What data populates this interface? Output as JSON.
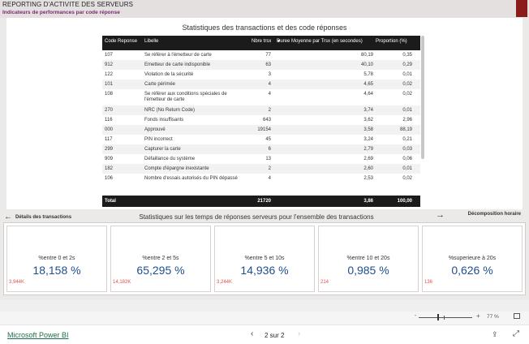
{
  "header": {
    "title": "REPORTING D'ACTIVITE DES SERVEURS",
    "subtitle": "Indicateurs de performances par code réponse"
  },
  "table": {
    "title": "Statistiques des transactions et des code réponses",
    "columns": [
      "Code Reponse",
      "Libelle",
      "Nbre trsx",
      "Duree Moyenne par Trsx (en secondes)",
      "Proportion (%)"
    ],
    "rows": [
      {
        "code": "107",
        "libelle": "Se référer à l'émetteur de carte",
        "nb": "77",
        "duree": "80,19",
        "pct": "0,35"
      },
      {
        "code": "912",
        "libelle": "Emetteur de carte indisponible",
        "nb": "63",
        "duree": "40,10",
        "pct": "0,29"
      },
      {
        "code": "122",
        "libelle": "Violation de la sécurité",
        "nb": "3",
        "duree": "5,78",
        "pct": "0,01"
      },
      {
        "code": "101",
        "libelle": "Carte périmée",
        "nb": "4",
        "duree": "4,65",
        "pct": "0,02"
      },
      {
        "code": "108",
        "libelle": "Se référer aux conditions spéciales de l'émetteur de carte",
        "nb": "4",
        "duree": "4,64",
        "pct": "0,02"
      },
      {
        "code": "270",
        "libelle": "NRC (No Return Code)",
        "nb": "2",
        "duree": "3,74",
        "pct": "0,01"
      },
      {
        "code": "116",
        "libelle": "Fonds insuffisants",
        "nb": "643",
        "duree": "3,62",
        "pct": "2,96"
      },
      {
        "code": "000",
        "libelle": "Approuvé",
        "nb": "19154",
        "duree": "3,58",
        "pct": "88,19"
      },
      {
        "code": "117",
        "libelle": "PIN incorrect",
        "nb": "45",
        "duree": "3,24",
        "pct": "0,21"
      },
      {
        "code": "299",
        "libelle": "Capturer la carte",
        "nb": "6",
        "duree": "2,79",
        "pct": "0,03"
      },
      {
        "code": "909",
        "libelle": "Défaillance du système",
        "nb": "13",
        "duree": "2,69",
        "pct": "0,06"
      },
      {
        "code": "182",
        "libelle": "Compte d'épargne inexistante",
        "nb": "2",
        "duree": "2,60",
        "pct": "0,01"
      },
      {
        "code": "106",
        "libelle": "Nombre d'essais autorisés du PIN dépassé",
        "nb": "4",
        "duree": "2,53",
        "pct": "0,02"
      }
    ],
    "total": {
      "label": "Total",
      "nb": "21720",
      "duree": "3,86",
      "pct": "100,00"
    }
  },
  "nav": {
    "left": "Détails des transactions",
    "right": "Décomposition horaire"
  },
  "stats": {
    "title": "Statistiques sur les temps de réponses serveurs pour l'ensemble des transactions",
    "cards": [
      {
        "label": "%entre 0 et 2s",
        "value": "18,158 %",
        "count": "3,944K"
      },
      {
        "label": "%entre 2 et 5s",
        "value": "65,295 %",
        "count": "14,182K"
      },
      {
        "label": "%entre 5 et 10s",
        "value": "14,936 %",
        "count": "3,244K"
      },
      {
        "label": "%entre 10 et 20s",
        "value": "0,985 %",
        "count": "214"
      },
      {
        "label": "%superieure à 20s",
        "value": "0,626 %",
        "count": "136"
      }
    ]
  },
  "zoom": {
    "minus": "-",
    "plus": "+",
    "level": "77 %"
  },
  "footer": {
    "brand": "Microsoft Power BI",
    "pager": "2 sur 2"
  },
  "colors": {
    "kpi_value": "#1d4f91",
    "kpi_count": "#e05050",
    "header_dark": "#1b1b1b",
    "accent_block": "#8b1a1a"
  },
  "icons": {
    "nav_left": "arrow-left-icon",
    "nav_right": "arrow-right-icon",
    "share": "share-icon",
    "fullscreen": "fullscreen-icon",
    "fit": "fit-to-page-icon"
  }
}
